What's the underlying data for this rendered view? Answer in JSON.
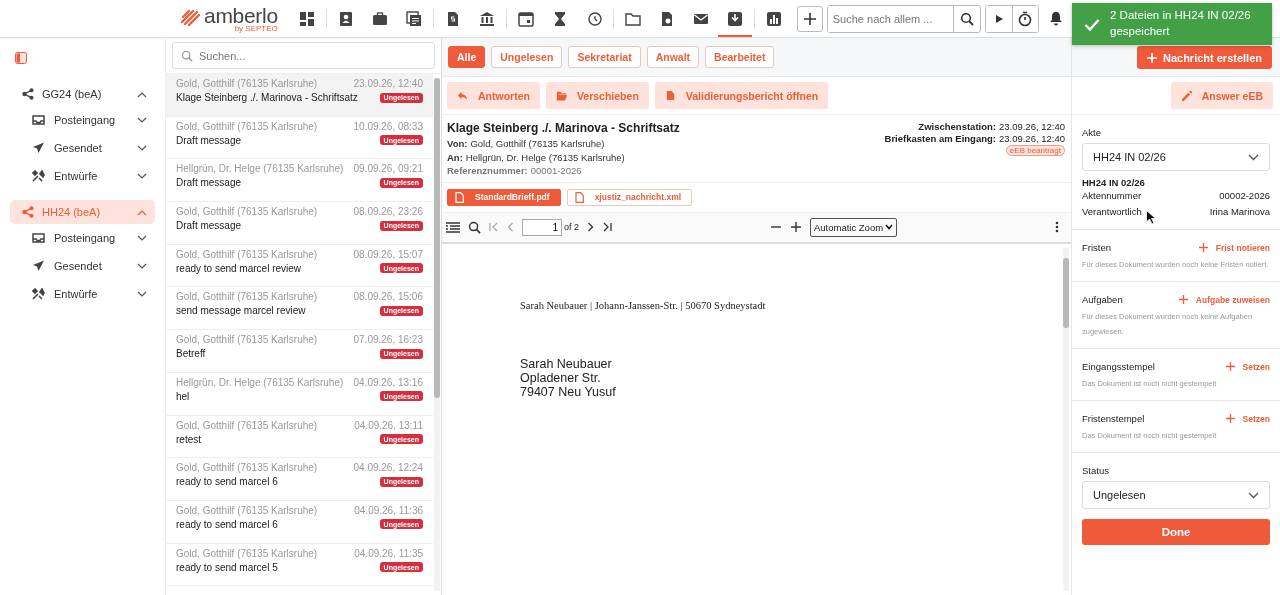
{
  "topbar": {
    "logo": "amberlo",
    "logo_sub": "by SEPTEO",
    "nav_groups": [
      [
        {
          "selected": false
        }
      ],
      [
        {
          "selected": false
        },
        {
          "selected": false
        },
        {
          "selected": false
        }
      ],
      [
        {
          "selected": false
        },
        {
          "selected": false
        }
      ],
      [
        {
          "selected": false
        },
        {
          "selected": false
        },
        {
          "selected": false
        }
      ],
      [
        {
          "selected": false
        },
        {
          "selected": false
        },
        {
          "selected": false
        },
        {
          "selected": true
        }
      ],
      [
        {
          "selected": false
        }
      ]
    ],
    "search": {
      "placeholder": "Suche nach allem ..."
    }
  },
  "toast": {
    "text": "2 Dateien in HH24 IN 02/26 gespeichert"
  },
  "sidebar": {
    "accounts": [
      {
        "label": "GG24 (beA)",
        "selected": false,
        "expanded": true,
        "children": [
          {
            "label": "Posteingang",
            "expanded": false
          },
          {
            "label": "Gesendet",
            "expanded": false
          },
          {
            "label": "Entwürfe",
            "expanded": false
          }
        ]
      },
      {
        "label": "HH24 (beA)",
        "selected": true,
        "expanded": true,
        "children": [
          {
            "label": "Posteingang",
            "expanded": false
          },
          {
            "label": "Gesendet",
            "expanded": false
          },
          {
            "label": "Entwürfe",
            "expanded": false
          }
        ]
      }
    ]
  },
  "message_list": {
    "search": {
      "placeholder": "Suchen..."
    },
    "items": [
      {
        "sender": "Gold, Gotthilf (76135 Karlsruhe)",
        "date": "23.09.26, 12:40",
        "subject": "Klage Steinberg ./. Marinova - Schriftsatz",
        "badge": "Ungelesen",
        "selected": true
      },
      {
        "sender": "Gold, Gotthilf (76135 Karlsruhe)",
        "date": "10.09.26, 08:33",
        "subject": "Draft message",
        "badge": "Ungelesen",
        "selected": false
      },
      {
        "sender": "Hellgrün, Dr. Helge (76135 Karlsruhe)",
        "date": "09.09.26, 09:21",
        "subject": "Draft message",
        "badge": "Ungelesen",
        "selected": false
      },
      {
        "sender": "Gold, Gotthilf (76135 Karlsruhe)",
        "date": "08.09.26, 23:26",
        "subject": "Draft message",
        "badge": "Ungelesen",
        "selected": false
      },
      {
        "sender": "Gold, Gotthilf (76135 Karlsruhe)",
        "date": "08.09.26, 15:07",
        "subject": "ready to send marcel review",
        "badge": "Ungelesen",
        "selected": false
      },
      {
        "sender": "Gold, Gotthilf (76135 Karlsruhe)",
        "date": "08.09.26, 15:06",
        "subject": "send message marcel review",
        "badge": "Ungelesen",
        "selected": false
      },
      {
        "sender": "Gold, Gotthilf (76135 Karlsruhe)",
        "date": "07.09.26, 16:23",
        "subject": "Betreff",
        "badge": "Ungelesen",
        "selected": false
      },
      {
        "sender": "Hellgrün, Dr. Helge (76135 Karlsruhe)",
        "date": "04.09.26, 13:16",
        "subject": "hel",
        "badge": "Ungelesen",
        "selected": false
      },
      {
        "sender": "Gold, Gotthilf (76135 Karlsruhe)",
        "date": "04.09.26, 13:11",
        "subject": "retest",
        "badge": "Ungelesen",
        "selected": false
      },
      {
        "sender": "Gold, Gotthilf (76135 Karlsruhe)",
        "date": "04.09.26, 12:24",
        "subject": "ready to send marcel 6",
        "badge": "Ungelesen",
        "selected": false
      },
      {
        "sender": "Gold, Gotthilf (76135 Karlsruhe)",
        "date": "04.09.26, 11:36",
        "subject": "ready to send marcel 6",
        "badge": "Ungelesen",
        "selected": false
      },
      {
        "sender": "Gold, Gotthilf (76135 Karlsruhe)",
        "date": "04.09.26, 11:35",
        "subject": "ready to send marcel 5",
        "badge": "Ungelesen",
        "selected": false
      }
    ]
  },
  "filters": [
    {
      "label": "Alle",
      "selected": true
    },
    {
      "label": "Ungelesen",
      "selected": false
    },
    {
      "label": "Sekretariat",
      "selected": false
    },
    {
      "label": "Anwalt",
      "selected": false
    },
    {
      "label": "Bearbeitet",
      "selected": false
    }
  ],
  "create_button": "Nachricht erstellen",
  "actions": [
    "Antworten",
    "Verschieben",
    "Validierungsbericht öffnen"
  ],
  "answer_button": "Answer eEB",
  "message": {
    "title": "Klage Steinberg ./. Marinova - Schriftsatz",
    "fields": [
      {
        "label": "Von:",
        "value": "Gold, Gotthilf (76135 Karlsruhe)"
      },
      {
        "label": "An:",
        "value": "Hellgrün, Dr. Helge (76135 Karlsruhe)"
      },
      {
        "label": "Referenznummer:",
        "value": "00001-2026"
      }
    ],
    "meta": [
      {
        "label": "Zwischenstation:",
        "value": "23.09.26, 12:40"
      },
      {
        "label": "Briefkasten am Eingang:",
        "value": "23.09.26, 12:40"
      }
    ],
    "tag": "eEB beantragt",
    "attachments": [
      {
        "name": "StandardBrieff.pdf",
        "selected": true
      },
      {
        "name": "xjustiz_nachricht.xml",
        "selected": false
      }
    ]
  },
  "pdf_viewer": {
    "page": "1",
    "page_count": "of 2",
    "zoom": "Automatic Zoom",
    "document": {
      "sender_line": "Sarah Neubauer | Johann-Janssen-Str. | 50670 Sydneystadt",
      "address": [
        "Sarah Neubauer",
        "Opladener Str.",
        "79407 Neu Yusuf"
      ]
    }
  },
  "details": {
    "akte_label": "Akte",
    "akte_value": "HH24 IN 02/26",
    "file_title": "HH24 IN 02/26",
    "rows": [
      {
        "label": "Aktennummer",
        "value": "00002-2026"
      },
      {
        "label": "Verantwortlich",
        "value": "Irina Marinova"
      }
    ],
    "sections": [
      {
        "title": "Fristen",
        "action": "Frist notieren",
        "note": "Für dieses Dokument wurden noch keine Fristen notiert."
      },
      {
        "title": "Aufgaben",
        "action": "Aufgabe zuweisen",
        "note": "Für dieses Dokument wurden noch keine Aufgaben zugewiesen."
      },
      {
        "title": "Eingangsstempel",
        "action": "Setzen",
        "note": "Das Dokument ist noch nicht gestempelt"
      },
      {
        "title": "Fristenstempel",
        "action": "Setzen",
        "note": "Das Dokument ist noch nicht gestempelt"
      }
    ],
    "status_label": "Status",
    "status_value": "Ungelesen",
    "done_button": "Done"
  }
}
